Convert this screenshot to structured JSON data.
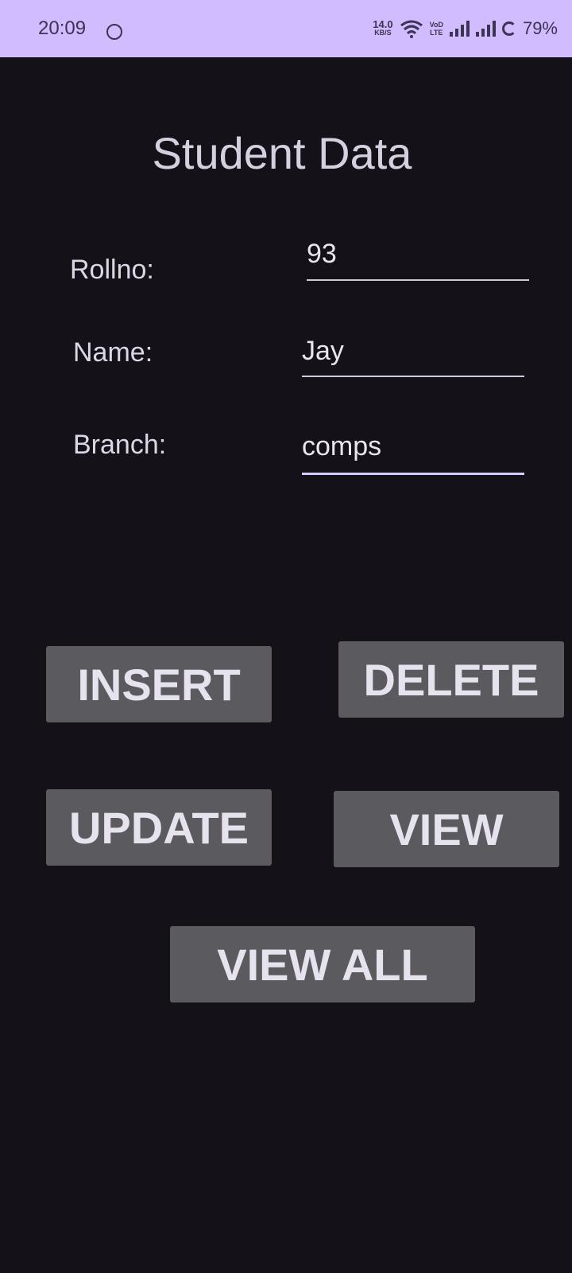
{
  "status_bar": {
    "time": "20:09",
    "net_speed_value": "14.0",
    "net_speed_unit": "KB/S",
    "volte_top": "VoD",
    "volte_bottom": "LTE",
    "battery": "79%",
    "icons": [
      "notification-icon",
      "wifi-icon",
      "signal-icon",
      "battery-icon"
    ]
  },
  "app": {
    "title": "Student Data",
    "fields": {
      "rollno": {
        "label": "Rollno:",
        "value": "93"
      },
      "name": {
        "label": "Name:",
        "value": "Jay"
      },
      "branch": {
        "label": "Branch:",
        "value": "comps"
      }
    },
    "buttons": {
      "insert": "INSERT",
      "delete": "DELETE",
      "update": "UPDATE",
      "view": "VIEW",
      "view_all": "VIEW ALL"
    }
  },
  "colors": {
    "status_bar_bg": "#d0bcfe",
    "background": "#141218",
    "button_bg": "#5b5a5f",
    "text": "#dcd7e6"
  }
}
